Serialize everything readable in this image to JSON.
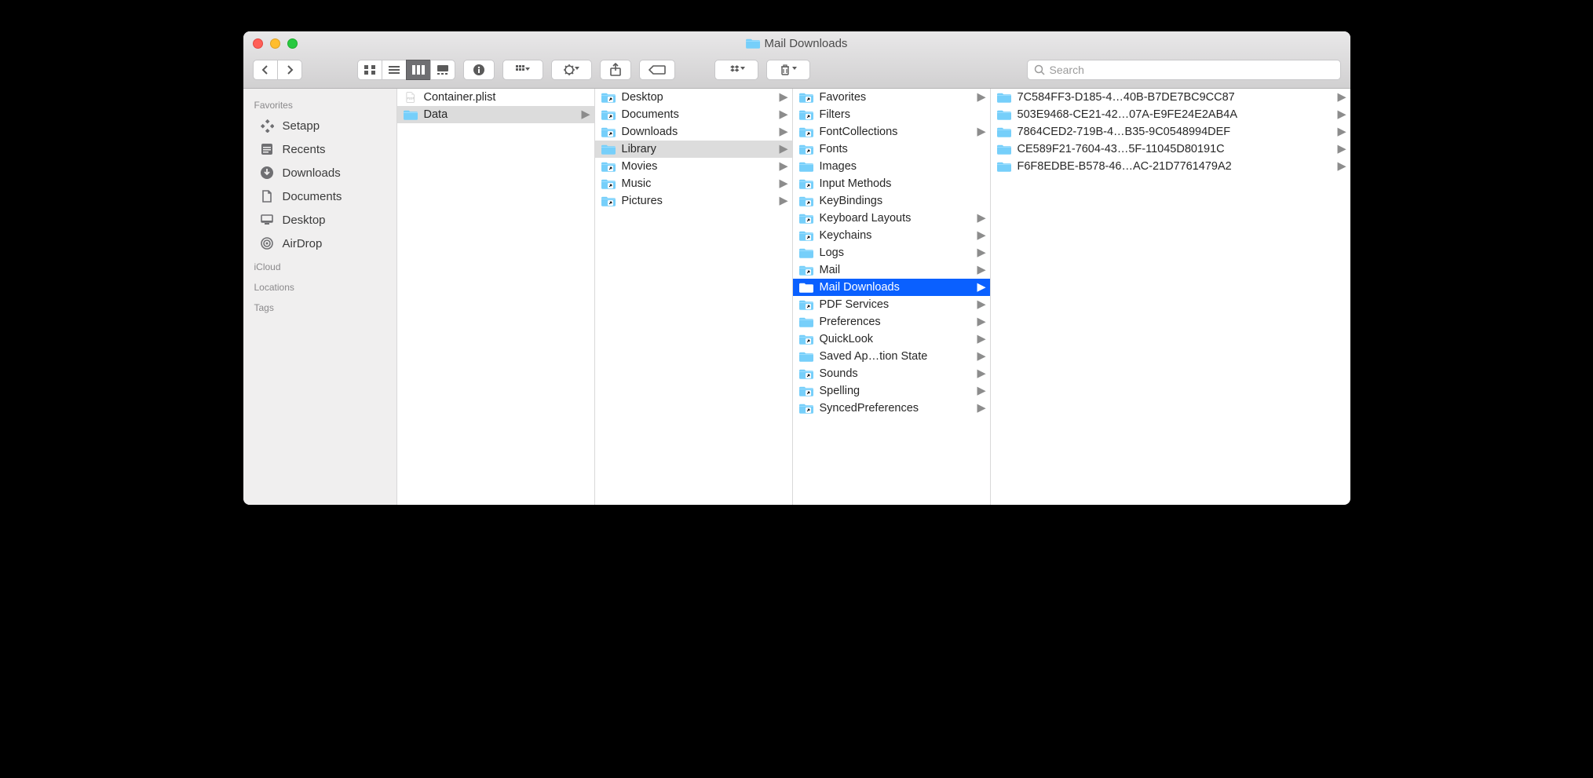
{
  "window_title": "Mail Downloads",
  "search_placeholder": "Search",
  "sidebar": {
    "sections": [
      {
        "heading": "Favorites",
        "items": [
          {
            "icon": "setapp",
            "label": "Setapp"
          },
          {
            "icon": "recents",
            "label": "Recents"
          },
          {
            "icon": "downloads",
            "label": "Downloads"
          },
          {
            "icon": "documents",
            "label": "Documents"
          },
          {
            "icon": "desktop",
            "label": "Desktop"
          },
          {
            "icon": "airdrop",
            "label": "AirDrop"
          }
        ]
      },
      {
        "heading": "iCloud",
        "items": []
      },
      {
        "heading": "Locations",
        "items": []
      },
      {
        "heading": "Tags",
        "items": []
      }
    ]
  },
  "columns": [
    {
      "items": [
        {
          "kind": "file",
          "icon": "plist",
          "label": "Container.plist",
          "has_children": false,
          "alias": false,
          "selected": null
        },
        {
          "kind": "folder",
          "label": "Data",
          "has_children": true,
          "alias": false,
          "selected": "gray"
        }
      ]
    },
    {
      "items": [
        {
          "kind": "folder",
          "label": "Desktop",
          "has_children": true,
          "alias": true,
          "selected": null
        },
        {
          "kind": "folder",
          "label": "Documents",
          "has_children": true,
          "alias": true,
          "selected": null
        },
        {
          "kind": "folder",
          "label": "Downloads",
          "has_children": true,
          "alias": true,
          "selected": null
        },
        {
          "kind": "folder",
          "label": "Library",
          "has_children": true,
          "alias": false,
          "selected": "gray"
        },
        {
          "kind": "folder",
          "label": "Movies",
          "has_children": true,
          "alias": true,
          "selected": null
        },
        {
          "kind": "folder",
          "label": "Music",
          "has_children": true,
          "alias": true,
          "selected": null
        },
        {
          "kind": "folder",
          "label": "Pictures",
          "has_children": true,
          "alias": true,
          "selected": null
        }
      ]
    },
    {
      "items": [
        {
          "kind": "folder",
          "label": "Favorites",
          "has_children": true,
          "alias": true,
          "selected": null
        },
        {
          "kind": "folder",
          "label": "Filters",
          "has_children": false,
          "alias": true,
          "selected": null
        },
        {
          "kind": "folder",
          "label": "FontCollections",
          "has_children": true,
          "alias": true,
          "selected": null
        },
        {
          "kind": "folder",
          "label": "Fonts",
          "has_children": false,
          "alias": true,
          "selected": null
        },
        {
          "kind": "folder",
          "label": "Images",
          "has_children": false,
          "alias": false,
          "selected": null
        },
        {
          "kind": "folder",
          "label": "Input Methods",
          "has_children": false,
          "alias": true,
          "selected": null
        },
        {
          "kind": "folder",
          "label": "KeyBindings",
          "has_children": false,
          "alias": true,
          "selected": null
        },
        {
          "kind": "folder",
          "label": "Keyboard Layouts",
          "has_children": true,
          "alias": true,
          "selected": null
        },
        {
          "kind": "folder",
          "label": "Keychains",
          "has_children": true,
          "alias": true,
          "selected": null
        },
        {
          "kind": "folder",
          "label": "Logs",
          "has_children": true,
          "alias": false,
          "selected": null
        },
        {
          "kind": "folder",
          "label": "Mail",
          "has_children": true,
          "alias": true,
          "selected": null
        },
        {
          "kind": "folder",
          "label": "Mail Downloads",
          "has_children": true,
          "alias": false,
          "selected": "blue"
        },
        {
          "kind": "folder",
          "label": "PDF Services",
          "has_children": true,
          "alias": true,
          "selected": null
        },
        {
          "kind": "folder",
          "label": "Preferences",
          "has_children": true,
          "alias": false,
          "selected": null
        },
        {
          "kind": "folder",
          "label": "QuickLook",
          "has_children": true,
          "alias": true,
          "selected": null
        },
        {
          "kind": "folder",
          "label": "Saved Ap…tion State",
          "has_children": true,
          "alias": false,
          "selected": null
        },
        {
          "kind": "folder",
          "label": "Sounds",
          "has_children": true,
          "alias": true,
          "selected": null
        },
        {
          "kind": "folder",
          "label": "Spelling",
          "has_children": true,
          "alias": true,
          "selected": null
        },
        {
          "kind": "folder",
          "label": "SyncedPreferences",
          "has_children": true,
          "alias": true,
          "selected": null
        }
      ]
    },
    {
      "items": [
        {
          "kind": "folder",
          "label": "7C584FF3-D185-4…40B-B7DE7BC9CC87",
          "has_children": true,
          "alias": false,
          "selected": null
        },
        {
          "kind": "folder",
          "label": "503E9468-CE21-42…07A-E9FE24E2AB4A",
          "has_children": true,
          "alias": false,
          "selected": null
        },
        {
          "kind": "folder",
          "label": "7864CED2-719B-4…B35-9C0548994DEF",
          "has_children": true,
          "alias": false,
          "selected": null
        },
        {
          "kind": "folder",
          "label": "CE589F21-7604-43…5F-11045D80191C",
          "has_children": true,
          "alias": false,
          "selected": null
        },
        {
          "kind": "folder",
          "label": "F6F8EDBE-B578-46…AC-21D7761479A2",
          "has_children": true,
          "alias": false,
          "selected": null
        }
      ]
    }
  ]
}
